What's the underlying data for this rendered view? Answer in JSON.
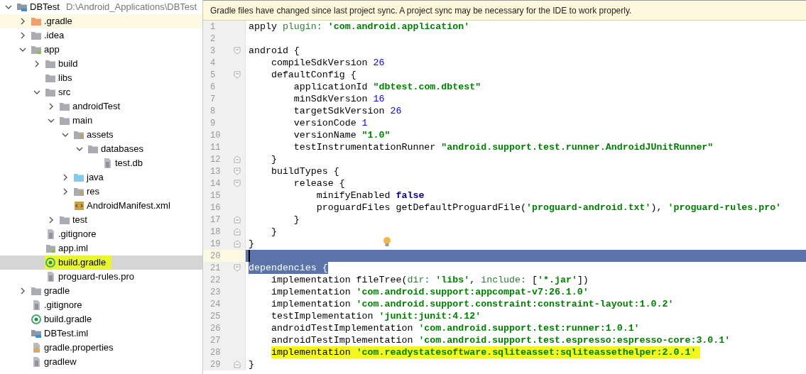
{
  "project_tree": [
    {
      "label": "DBTest",
      "path": "D:\\Android_Applications\\DBTest",
      "kind": "module",
      "expanded": true,
      "selected": false,
      "children": [
        {
          "label": ".gradle",
          "kind": "excluded_folder",
          "expanded": false,
          "selected": false,
          "hovered": true
        },
        {
          "label": ".idea",
          "kind": "folder",
          "expanded": false,
          "selected": false
        },
        {
          "label": "app",
          "kind": "module_folder",
          "expanded": true,
          "selected": false,
          "children": [
            {
              "label": "build",
              "kind": "folder",
              "expanded": false,
              "selected": false
            },
            {
              "label": "libs",
              "kind": "folder",
              "selected": false
            },
            {
              "label": "src",
              "kind": "folder",
              "expanded": true,
              "selected": false,
              "children": [
                {
                  "label": "androidTest",
                  "kind": "folder",
                  "expanded": false,
                  "selected": false
                },
                {
                  "label": "main",
                  "kind": "folder",
                  "expanded": true,
                  "selected": false,
                  "children": [
                    {
                      "label": "assets",
                      "kind": "resource_folder",
                      "expanded": true,
                      "selected": false,
                      "children": [
                        {
                          "label": "databases",
                          "kind": "folder",
                          "expanded": true,
                          "selected": false,
                          "children": [
                            {
                              "label": "test.db",
                              "kind": "text_file",
                              "selected": false
                            }
                          ]
                        }
                      ]
                    },
                    {
                      "label": "java",
                      "kind": "source_folder",
                      "expanded": false,
                      "selected": false
                    },
                    {
                      "label": "res",
                      "kind": "resource_folder",
                      "expanded": false,
                      "selected": false
                    },
                    {
                      "label": "AndroidManifest.xml",
                      "kind": "manifest",
                      "selected": false
                    }
                  ]
                },
                {
                  "label": "test",
                  "kind": "folder",
                  "expanded": false,
                  "selected": false
                }
              ]
            },
            {
              "label": ".gitignore",
              "kind": "text_file",
              "selected": false
            },
            {
              "label": "app.iml",
              "kind": "iml_file",
              "selected": false
            },
            {
              "label": "build.gradle",
              "kind": "gradle",
              "selected": true,
              "marked": true
            },
            {
              "label": "proguard-rules.pro",
              "kind": "text_file",
              "selected": false
            }
          ]
        },
        {
          "label": "gradle",
          "kind": "folder",
          "expanded": false,
          "selected": false
        },
        {
          "label": ".gitignore",
          "kind": "text_file",
          "selected": false
        },
        {
          "label": "build.gradle",
          "kind": "gradle",
          "selected": false
        },
        {
          "label": "DBTest.iml",
          "kind": "module_file",
          "selected": false
        },
        {
          "label": "gradle.properties",
          "kind": "properties",
          "selected": false
        },
        {
          "label": "gradlew",
          "kind": "text_file",
          "selected": false
        }
      ]
    }
  ],
  "notification": "Gradle files have changed since last project sync. A project sync may be necessary for the IDE to work properly.",
  "editor_lines": [
    {
      "number": "1",
      "kind": "plain",
      "tokens": [
        {
          "kind": "plain",
          "text": "apply "
        },
        {
          "kind": "named",
          "text": "plugin: "
        },
        {
          "kind": "string",
          "text": "'com.android.application'"
        }
      ]
    },
    {
      "number": "2",
      "kind": "plain"
    },
    {
      "number": "3",
      "kind": "fold_start",
      "tokens": [
        {
          "kind": "plain",
          "text": "android {"
        }
      ]
    },
    {
      "number": "4",
      "kind": "plain",
      "tokens": [
        {
          "kind": "plain",
          "text": "    compileSdkVersion "
        },
        {
          "kind": "number",
          "text": "26"
        }
      ]
    },
    {
      "number": "5",
      "kind": "fold_start",
      "tokens": [
        {
          "kind": "plain",
          "text": "    defaultConfig {"
        }
      ]
    },
    {
      "number": "6",
      "kind": "plain",
      "tokens": [
        {
          "kind": "plain",
          "text": "        applicationId "
        },
        {
          "kind": "string",
          "text": "\"dbtest.com.dbtest\""
        }
      ]
    },
    {
      "number": "7",
      "kind": "plain",
      "tokens": [
        {
          "kind": "plain",
          "text": "        minSdkVersion "
        },
        {
          "kind": "number",
          "text": "16"
        }
      ]
    },
    {
      "number": "8",
      "kind": "plain",
      "tokens": [
        {
          "kind": "plain",
          "text": "        targetSdkVersion "
        },
        {
          "kind": "number",
          "text": "26"
        }
      ]
    },
    {
      "number": "9",
      "kind": "plain",
      "tokens": [
        {
          "kind": "plain",
          "text": "        versionCode "
        },
        {
          "kind": "number",
          "text": "1"
        }
      ]
    },
    {
      "number": "10",
      "kind": "plain",
      "tokens": [
        {
          "kind": "plain",
          "text": "        versionName "
        },
        {
          "kind": "string",
          "text": "\"1.0\""
        }
      ]
    },
    {
      "number": "11",
      "kind": "plain",
      "tokens": [
        {
          "kind": "plain",
          "text": "        testInstrumentationRunner "
        },
        {
          "kind": "string",
          "text": "\"android.support.test.runner.AndroidJUnitRunner\""
        }
      ]
    },
    {
      "number": "12",
      "kind": "fold_end",
      "tokens": [
        {
          "kind": "plain",
          "text": "    }"
        }
      ]
    },
    {
      "number": "13",
      "kind": "fold_start",
      "tokens": [
        {
          "kind": "plain",
          "text": "    buildTypes {"
        }
      ]
    },
    {
      "number": "14",
      "kind": "fold_start",
      "tokens": [
        {
          "kind": "plain",
          "text": "        release {"
        }
      ]
    },
    {
      "number": "15",
      "kind": "plain",
      "tokens": [
        {
          "kind": "plain",
          "text": "            minifyEnabled "
        },
        {
          "kind": "keyword",
          "text": "false"
        }
      ]
    },
    {
      "number": "16",
      "kind": "plain",
      "tokens": [
        {
          "kind": "plain",
          "text": "            proguardFiles getDefaultProguardFile("
        },
        {
          "kind": "string",
          "text": "'proguard-android.txt'"
        },
        {
          "kind": "plain",
          "text": "), "
        },
        {
          "kind": "string",
          "text": "'proguard-rules.pro'"
        }
      ]
    },
    {
      "number": "17",
      "kind": "fold_end",
      "tokens": [
        {
          "kind": "plain",
          "text": "        }"
        }
      ]
    },
    {
      "number": "18",
      "kind": "fold_end",
      "tokens": [
        {
          "kind": "plain",
          "text": "    }"
        }
      ]
    },
    {
      "number": "19",
      "kind": "fold_end",
      "bulb": true,
      "tokens": [
        {
          "kind": "plain",
          "text": "}"
        }
      ]
    },
    {
      "number": "20",
      "kind": "plain",
      "selected": true,
      "caret": true
    },
    {
      "number": "21",
      "kind": "fold_start",
      "tokens": [
        {
          "kind": "plain",
          "text": "dependencies {",
          "selected": true
        }
      ]
    },
    {
      "number": "22",
      "kind": "plain",
      "tokens": [
        {
          "kind": "plain",
          "text": "    implementation fileTree("
        },
        {
          "kind": "named",
          "text": "dir: "
        },
        {
          "kind": "string",
          "text": "'libs'"
        },
        {
          "kind": "plain",
          "text": ", "
        },
        {
          "kind": "named",
          "text": "include: "
        },
        {
          "kind": "plain",
          "text": "["
        },
        {
          "kind": "string",
          "text": "'*.jar'"
        },
        {
          "kind": "plain",
          "text": "])"
        }
      ]
    },
    {
      "number": "23",
      "kind": "plain",
      "tokens": [
        {
          "kind": "plain",
          "text": "    implementation "
        },
        {
          "kind": "string",
          "text": "'com.android.support:appcompat-v7:26.1.0'"
        }
      ]
    },
    {
      "number": "24",
      "kind": "plain",
      "tokens": [
        {
          "kind": "plain",
          "text": "    implementation "
        },
        {
          "kind": "string",
          "text": "'com.android.support.constraint:constraint-layout:1.0.2'"
        }
      ]
    },
    {
      "number": "25",
      "kind": "plain",
      "tokens": [
        {
          "kind": "plain",
          "text": "    testImplementation "
        },
        {
          "kind": "string",
          "text": "'junit:junit:4.12'"
        }
      ]
    },
    {
      "number": "26",
      "kind": "plain",
      "tokens": [
        {
          "kind": "plain",
          "text": "    androidTestImplementation "
        },
        {
          "kind": "string",
          "text": "'com.android.support.test:runner:1.0.1'"
        }
      ]
    },
    {
      "number": "27",
      "kind": "plain",
      "tokens": [
        {
          "kind": "plain",
          "text": "    androidTestImplementation "
        },
        {
          "kind": "string",
          "text": "'com.android.support.test.espresso:espresso-core:3.0.1'"
        }
      ]
    },
    {
      "number": "28",
      "kind": "plain",
      "marked": true,
      "tokens": [
        {
          "kind": "plain",
          "text": "    implementation "
        },
        {
          "kind": "string",
          "text": "'com.readystatesoftware.sqliteasset:sqliteassethelper:2.0.1'"
        }
      ]
    },
    {
      "number": "29",
      "kind": "fold_end",
      "tokens": [
        {
          "kind": "plain",
          "text": "}"
        }
      ]
    }
  ]
}
